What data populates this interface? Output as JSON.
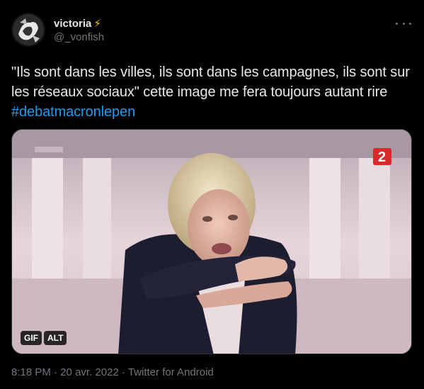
{
  "tweet": {
    "display_name": "victoria",
    "name_emoji": "⚡",
    "handle": "@_vonfish",
    "text_part1": "\"Ils sont dans les villes, ils sont dans les campagnes, ils sont sur les réseaux sociaux\" cette image me fera toujours autant rire ",
    "hashtag": "#debatmacronlepen",
    "time": "8:18 PM",
    "date": "20 avr. 2022",
    "source": "Twitter for Android",
    "separator": "·"
  },
  "media": {
    "badge_gif": "GIF",
    "badge_alt": "ALT",
    "channel_logo": "2"
  },
  "icons": {
    "more": "more-icon"
  },
  "colors": {
    "background": "#000000",
    "text": "#e7e9ea",
    "secondary": "#71767b",
    "link": "#1d9bf0",
    "bolt": "#f4c400"
  }
}
